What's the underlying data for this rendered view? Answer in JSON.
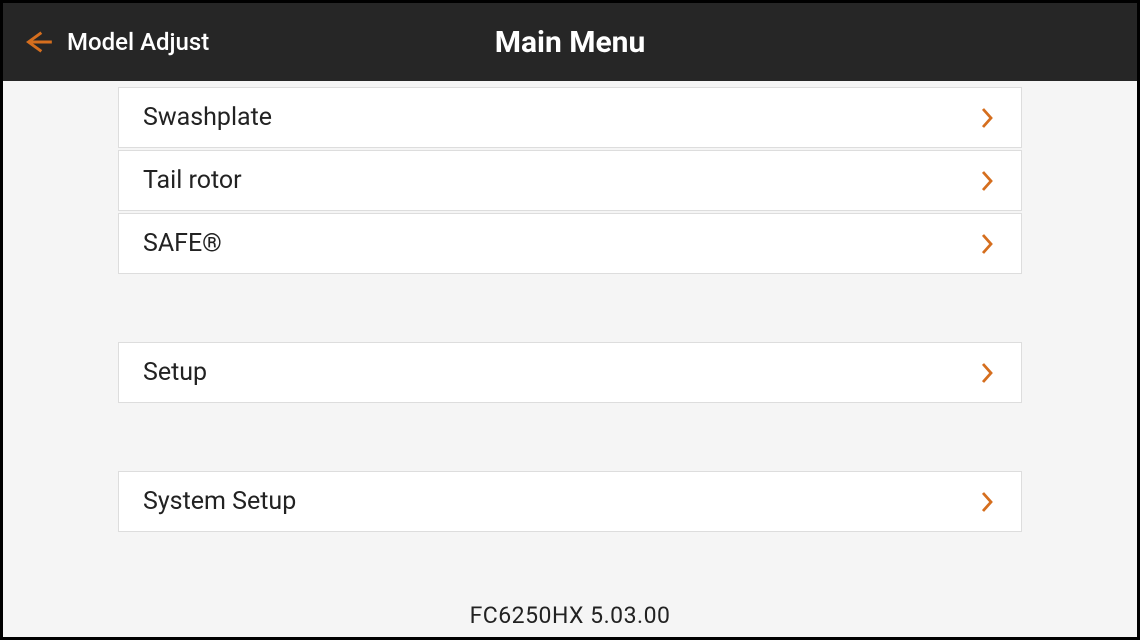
{
  "header": {
    "back_label": "Model Adjust",
    "title": "Main Menu"
  },
  "menu": {
    "group1": [
      {
        "label": "Swashplate"
      },
      {
        "label": "Tail rotor"
      },
      {
        "label": "SAFE®"
      }
    ],
    "group2": [
      {
        "label": "Setup"
      }
    ],
    "group3": [
      {
        "label": "System Setup"
      }
    ]
  },
  "footer": {
    "version": "FC6250HX 5.03.00"
  },
  "colors": {
    "accent": "#d56e1e",
    "header_bg": "#262626",
    "body_bg": "#f5f5f5"
  }
}
